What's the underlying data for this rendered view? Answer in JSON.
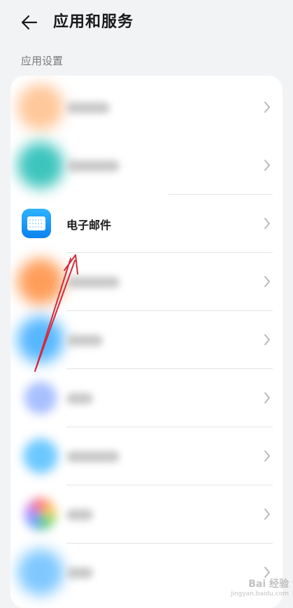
{
  "header": {
    "back_icon": "arrow-left-icon",
    "title": "应用和服务"
  },
  "section": {
    "label": "应用设置"
  },
  "items": [
    {
      "label": "电子邮件",
      "icon": "email-app-icon",
      "accent": "#1a96f5"
    }
  ],
  "watermark": {
    "text": "Bai 经验",
    "sub": "jingyan.baidu.com"
  }
}
